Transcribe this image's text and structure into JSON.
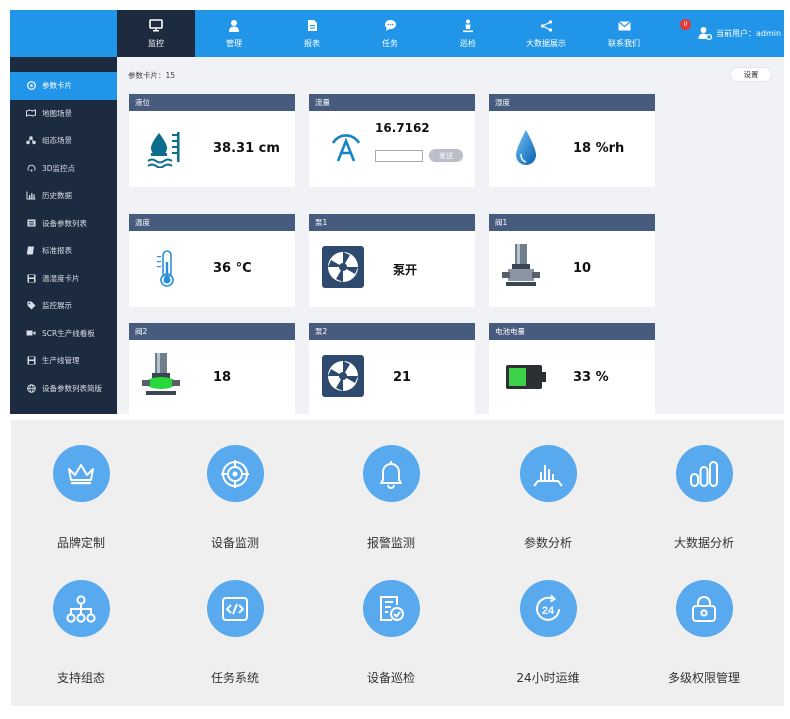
{
  "nav": {
    "items": [
      {
        "label": "监控",
        "icon": "monitor-icon"
      },
      {
        "label": "管理",
        "icon": "user-icon"
      },
      {
        "label": "报表",
        "icon": "document-icon"
      },
      {
        "label": "任务",
        "icon": "chat-icon"
      },
      {
        "label": "巡检",
        "icon": "inspector-icon"
      },
      {
        "label": "大数据展示",
        "icon": "share-icon"
      },
      {
        "label": "联系我们",
        "icon": "mail-icon"
      }
    ],
    "badge_count": "0",
    "user_label": "当前用户：admin"
  },
  "sidebar": {
    "items": [
      {
        "label": "参数卡片",
        "icon": "card-icon"
      },
      {
        "label": "地图场景",
        "icon": "map-icon"
      },
      {
        "label": "组态场景",
        "icon": "network-icon"
      },
      {
        "label": "3D监控点",
        "icon": "3d-icon"
      },
      {
        "label": "历史数据",
        "icon": "chart-icon"
      },
      {
        "label": "设备参数列表",
        "icon": "list-icon"
      },
      {
        "label": "标准报表",
        "icon": "report-icon"
      },
      {
        "label": "温湿度卡片",
        "icon": "save-icon"
      },
      {
        "label": "监控展示",
        "icon": "tag-icon"
      },
      {
        "label": "SCR生产线看板",
        "icon": "video-icon"
      },
      {
        "label": "生产线管理",
        "icon": "save-icon"
      },
      {
        "label": "设备参数列表简版",
        "icon": "globe-icon"
      }
    ]
  },
  "content": {
    "count_label": "参数卡片：15",
    "settings_label": "设置",
    "send_label": "发送"
  },
  "cards": [
    {
      "title": "液位",
      "value": "38.31 cm",
      "icon": "water-level-icon"
    },
    {
      "title": "流量",
      "value": "16.7162",
      "icon": "flow-icon"
    },
    {
      "title": "湿度",
      "value": "18 %rh",
      "icon": "water-drop-icon"
    },
    {
      "title": "温度",
      "value": "36 °C",
      "icon": "thermometer-icon"
    },
    {
      "title": "泵1",
      "value": "泵开",
      "icon": "pump-icon"
    },
    {
      "title": "阀1",
      "value": "10",
      "icon": "valve-icon"
    },
    {
      "title": "阀2",
      "value": "18",
      "icon": "valve-green-icon"
    },
    {
      "title": "泵2",
      "value": "21",
      "icon": "pump-icon"
    },
    {
      "title": "电池电量",
      "value": "33 %",
      "icon": "battery-icon"
    }
  ],
  "features": [
    {
      "label": "品牌定制",
      "icon": "crown-icon"
    },
    {
      "label": "设备监测",
      "icon": "target-icon"
    },
    {
      "label": "报警监测",
      "icon": "bell-icon"
    },
    {
      "label": "参数分析",
      "icon": "bar-chart-icon"
    },
    {
      "label": "大数据分析",
      "icon": "pillars-icon"
    },
    {
      "label": "支持组态",
      "icon": "hierarchy-icon"
    },
    {
      "label": "任务系统",
      "icon": "code-icon"
    },
    {
      "label": "设备巡检",
      "icon": "inspection-icon"
    },
    {
      "label": "24小时运维",
      "icon": "clock-24-icon"
    },
    {
      "label": "多级权限管理",
      "icon": "lock-icon"
    }
  ],
  "colors": {
    "nav_blue": "#2196e8",
    "sidebar_dark": "#1c2b3f",
    "card_header": "#475b7e",
    "feature_circle": "#58a9ee"
  }
}
